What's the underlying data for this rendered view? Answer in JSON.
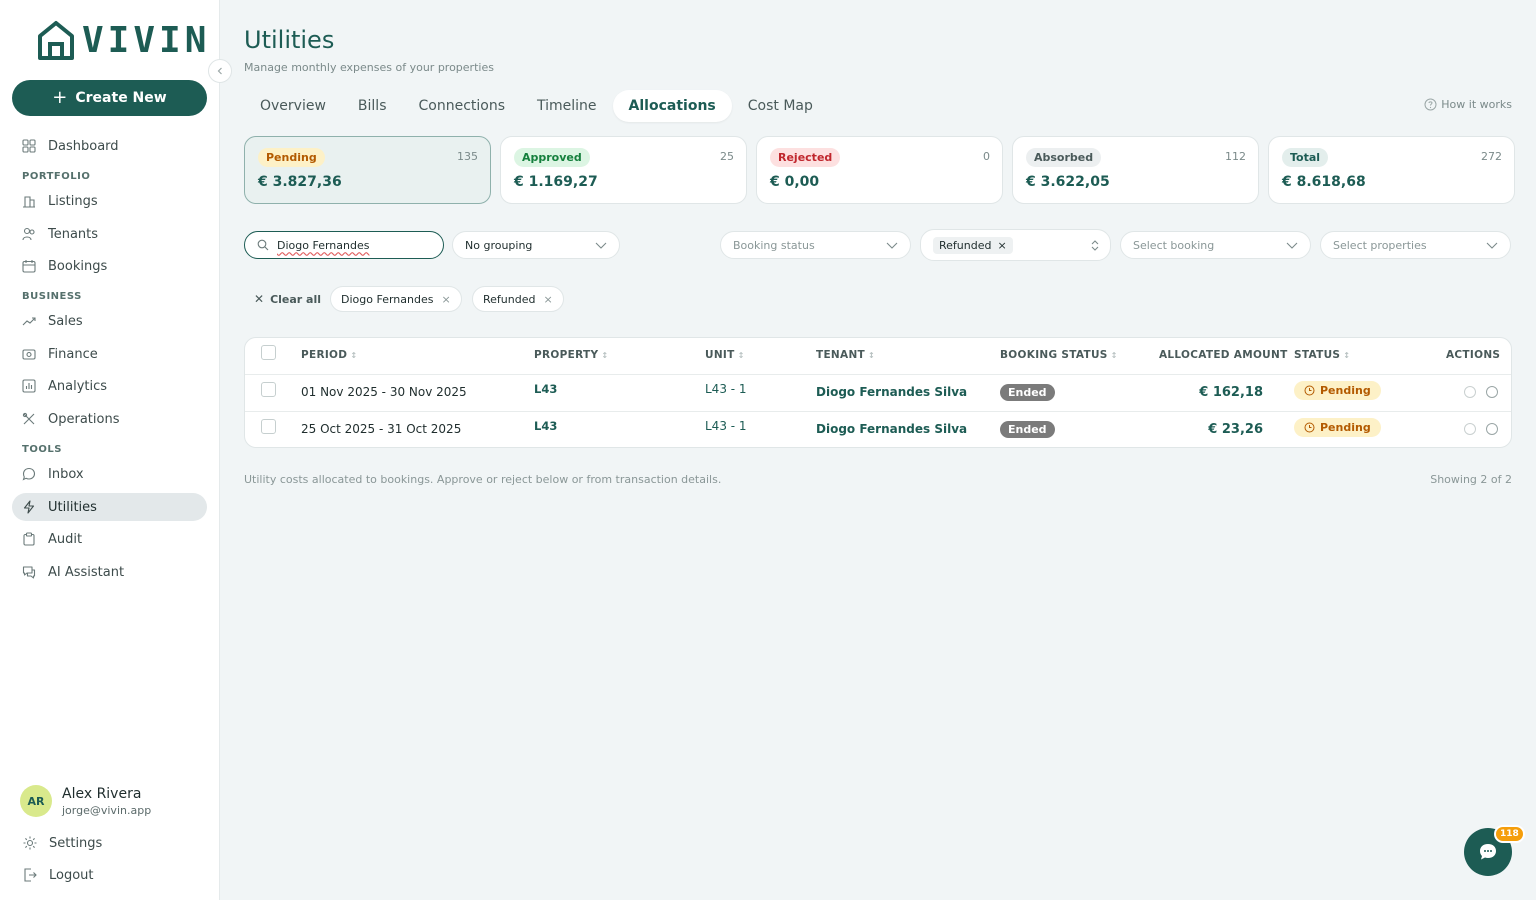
{
  "brand": {
    "name": "VIVIN",
    "accent": "#1d5c54"
  },
  "sidebar": {
    "create_label": "Create New",
    "dashboard": "Dashboard",
    "sections": {
      "portfolio": "PORTFOLIO",
      "business": "BUSINESS",
      "tools": "TOOLS"
    },
    "items": {
      "listings": "Listings",
      "tenants": "Tenants",
      "bookings": "Bookings",
      "sales": "Sales",
      "finance": "Finance",
      "analytics": "Analytics",
      "operations": "Operations",
      "inbox": "Inbox",
      "utilities": "Utilities",
      "audit": "Audit",
      "ai_assistant": "AI Assistant"
    },
    "user": {
      "initials": "AR",
      "name": "Alex Rivera",
      "email": "jorge@vivin.app"
    },
    "settings": "Settings",
    "logout": "Logout"
  },
  "header": {
    "title": "Utilities",
    "subtitle": "Manage monthly expenses of your properties",
    "how_it_works": "How it works"
  },
  "tabs": [
    "Overview",
    "Bills",
    "Connections",
    "Timeline",
    "Allocations",
    "Cost Map"
  ],
  "active_tab": "Allocations",
  "cards": [
    {
      "label": "Pending",
      "count": "135",
      "amount": "€ 3.827,36",
      "color": "#b35a00",
      "bg": "#fdf1c7"
    },
    {
      "label": "Approved",
      "count": "25",
      "amount": "€ 1.169,27",
      "color": "#15803d",
      "bg": "#dcf5e3"
    },
    {
      "label": "Rejected",
      "count": "0",
      "amount": "€ 0,00",
      "color": "#c0262d",
      "bg": "#fde0e0"
    },
    {
      "label": "Absorbed",
      "count": "112",
      "amount": "€ 3.622,05",
      "color": "#4a5a5a",
      "bg": "#eceff0"
    },
    {
      "label": "Total",
      "count": "272",
      "amount": "€ 8.618,68",
      "color": "#1d5c54",
      "bg": "#e3eeec"
    }
  ],
  "filters": {
    "search_value": "Diogo Fernandes",
    "grouping": "No grouping",
    "booking_status_placeholder": "Booking status",
    "status_selected": "Refunded",
    "booking_placeholder": "Select booking",
    "properties_placeholder": "Select properties"
  },
  "active_chips": {
    "clear_all": "Clear all",
    "chips": [
      "Diogo Fernandes",
      "Refunded"
    ]
  },
  "table": {
    "headers": {
      "period": "PERIOD",
      "property": "PROPERTY",
      "unit": "UNIT",
      "tenant": "TENANT",
      "booking_status": "BOOKING STATUS",
      "allocated_amount": "ALLOCATED AMOUNT",
      "status": "STATUS",
      "actions": "ACTIONS"
    },
    "rows": [
      {
        "period": "01 Nov 2025 - 30 Nov 2025",
        "property": "L43",
        "unit": "L43 - 1",
        "tenant": "Diogo Fernandes Silva",
        "booking_status": "Ended",
        "amount": "€ 162,18",
        "status": "Pending"
      },
      {
        "period": "25 Oct 2025 - 31 Oct 2025",
        "property": "L43",
        "unit": "L43 - 1",
        "tenant": "Diogo Fernandes Silva",
        "booking_status": "Ended",
        "amount": "€ 23,26",
        "status": "Pending"
      }
    ]
  },
  "footer": {
    "note": "Utility costs allocated to bookings. Approve or reject below or from transaction details.",
    "showing": "Showing 2 of 2"
  },
  "chat": {
    "badge": "118"
  }
}
